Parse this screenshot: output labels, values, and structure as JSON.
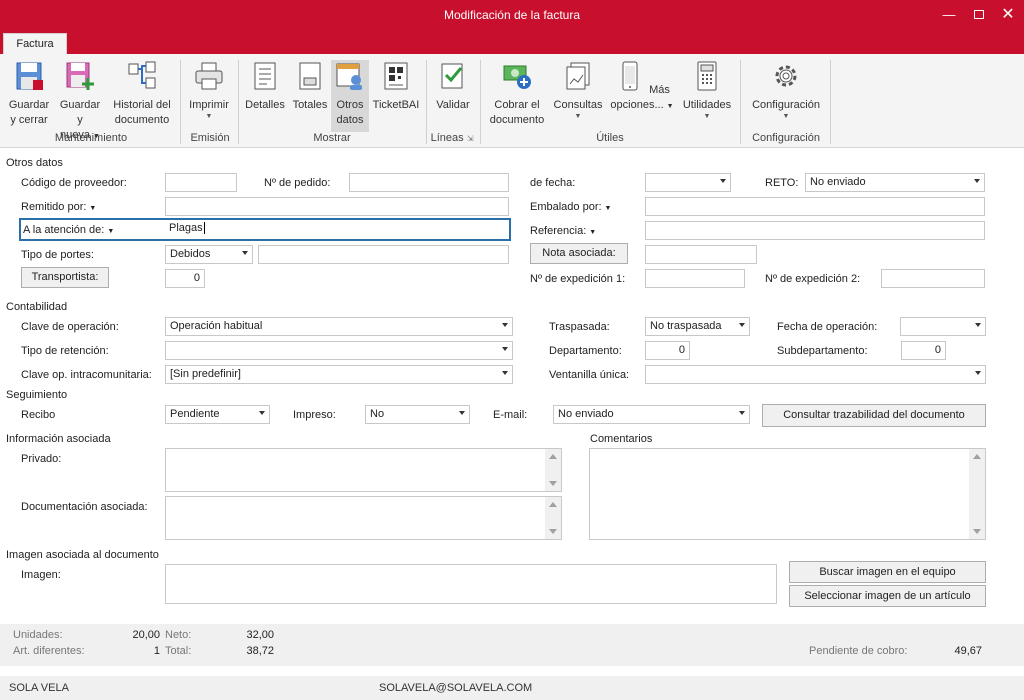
{
  "window": {
    "title": "Modificación de la factura"
  },
  "tabs": [
    "Factura"
  ],
  "ribbon": {
    "buttons": [
      {
        "id": "guardar-cerrar",
        "line1": "Guardar",
        "line2": "y cerrar"
      },
      {
        "id": "guardar-nueva",
        "line1": "Guardar",
        "line2": "y nueva"
      },
      {
        "id": "historial",
        "line1": "Historial del",
        "line2": "documento"
      },
      {
        "id": "imprimir",
        "line1": "Imprimir",
        "line2": ""
      },
      {
        "id": "detalles",
        "line1": "Detalles",
        "line2": ""
      },
      {
        "id": "totales",
        "line1": "Totales",
        "line2": ""
      },
      {
        "id": "otros-datos",
        "line1": "Otros",
        "line2": "datos"
      },
      {
        "id": "ticketbai",
        "line1": "TicketBAI",
        "line2": ""
      },
      {
        "id": "validar",
        "line1": "Validar",
        "line2": ""
      },
      {
        "id": "cobrar",
        "line1": "Cobrar el",
        "line2": "documento"
      },
      {
        "id": "consultas",
        "line1": "Consultas",
        "line2": ""
      },
      {
        "id": "mas-opciones",
        "line1": "Más",
        "line2": "opciones..."
      },
      {
        "id": "utilidades",
        "line1": "Utilidades",
        "line2": ""
      },
      {
        "id": "configuracion",
        "line1": "Configuración",
        "line2": ""
      }
    ],
    "groups": [
      "Mantenimiento",
      "Emisión",
      "Mostrar",
      "Líneas",
      "Útiles",
      "Configuración"
    ]
  },
  "otros_datos": {
    "section": "Otros datos",
    "codigo_proveedor": {
      "label": "Código de proveedor:",
      "value": ""
    },
    "n_pedido": {
      "label": "Nº de pedido:",
      "value": ""
    },
    "de_fecha": {
      "label": "de fecha:",
      "value": ""
    },
    "reto": {
      "label": "RETO:",
      "value": "No enviado"
    },
    "remitido_por": {
      "label": "Remitido por:",
      "value": ""
    },
    "embalado_por": {
      "label": "Embalado por:",
      "value": ""
    },
    "a_la_atencion": {
      "label": "A la atención de:",
      "value": "Plagas"
    },
    "referencia": {
      "label": "Referencia:",
      "value": ""
    },
    "tipo_portes": {
      "label": "Tipo de portes:",
      "value": "Debidos",
      "extra": ""
    },
    "nota_asociada": {
      "label": "Nota asociada:",
      "value": ""
    },
    "transportista": {
      "label": "Transportista:",
      "value": "0"
    },
    "n_expedicion_1": {
      "label": "Nº de expedición 1:",
      "value": ""
    },
    "n_expedicion_2": {
      "label": "Nº de expedición 2:",
      "value": ""
    }
  },
  "contabilidad": {
    "section": "Contabilidad",
    "clave_operacion": {
      "label": "Clave de operación:",
      "value": "Operación habitual"
    },
    "traspasada": {
      "label": "Traspasada:",
      "value": "No traspasada"
    },
    "fecha_operacion": {
      "label": "Fecha de operación:",
      "value": ""
    },
    "tipo_retencion": {
      "label": "Tipo de retención:",
      "value": ""
    },
    "departamento": {
      "label": "Departamento:",
      "value": "0"
    },
    "subdepartamento": {
      "label": "Subdepartamento:",
      "value": "0"
    },
    "clave_intracomunitaria": {
      "label": "Clave op. intracomunitaria:",
      "value": "[Sin predefinir]"
    },
    "ventanilla_unica": {
      "label": "Ventanilla única:",
      "value": ""
    }
  },
  "seguimiento": {
    "section": "Seguimiento",
    "recibo": {
      "label": "Recibo",
      "value": "Pendiente"
    },
    "impreso": {
      "label": "Impreso:",
      "value": "No"
    },
    "email": {
      "label": "E-mail:",
      "value": "No enviado"
    },
    "trazabilidad_button": "Consultar trazabilidad del documento"
  },
  "informacion": {
    "section": "Información asociada",
    "privado_label": "Privado:",
    "documentacion_label": "Documentación asociada:",
    "comentarios_label": "Comentarios"
  },
  "imagen": {
    "section": "Imagen asociada al documento",
    "label": "Imagen:",
    "buscar_button": "Buscar imagen en el equipo",
    "seleccionar_button": "Seleccionar imagen de un artículo"
  },
  "totals": {
    "unidades_label": "Unidades:",
    "unidades": "20,00",
    "art_label": "Art. diferentes:",
    "art": "1",
    "neto_label": "Neto:",
    "neto": "32,00",
    "total_label": "Total:",
    "total": "38,72",
    "pendiente_label": "Pendiente de cobro:",
    "pendiente": "49,67"
  },
  "status": {
    "company": "SOLA VELA",
    "email": "SOLAVELA@SOLAVELA.COM"
  },
  "colors": {
    "titlebar": "#c8102e",
    "focus": "#2a6fa8"
  }
}
